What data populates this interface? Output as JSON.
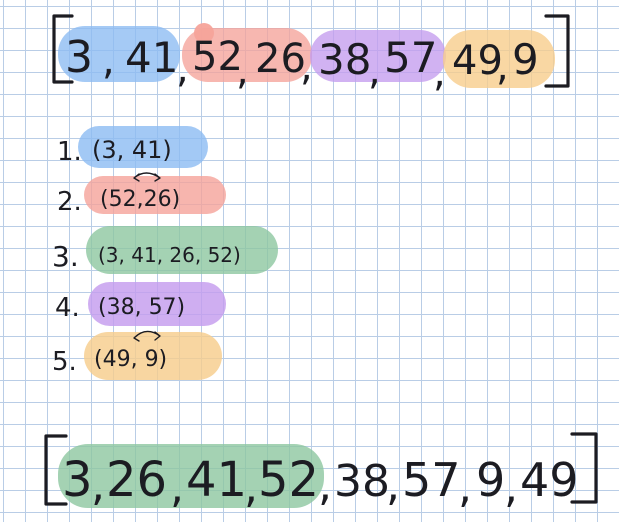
{
  "colors": {
    "blue": "#8cbbf2",
    "red": "#f5a39a",
    "purple": "#c49cee",
    "orange": "#f7cd8c",
    "green": "#8dc7a0",
    "ink": "#1c1c22"
  },
  "top_array": {
    "tokens": [
      "3",
      ",",
      "41",
      ",",
      "52",
      ",",
      "26",
      ",",
      "38",
      ",",
      "57",
      ",",
      "49",
      ",",
      "9"
    ]
  },
  "steps": [
    {
      "number": "1.",
      "text": "(3, 41)",
      "color": "blue"
    },
    {
      "number": "2.",
      "text": "(52,26)",
      "color": "red"
    },
    {
      "number": "3.",
      "text": "(3, 41, 26, 52)",
      "color": "green"
    },
    {
      "number": "4.",
      "text": "(38, 57)",
      "color": "purple"
    },
    {
      "number": "5.",
      "text": "(49, 9)",
      "color": "orange"
    }
  ],
  "bottom_array": {
    "tokens": [
      "3",
      ",",
      "26",
      ",",
      "41",
      ",",
      "52",
      ",",
      "38",
      ",",
      "57",
      ",",
      "9",
      ",",
      "49"
    ]
  }
}
